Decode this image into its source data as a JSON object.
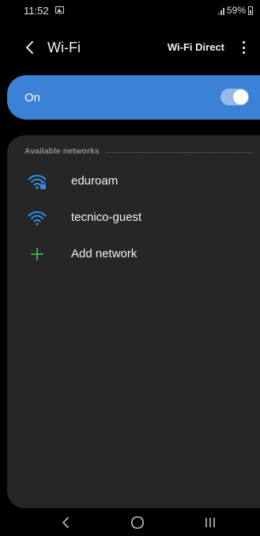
{
  "status_bar": {
    "time": "11:52",
    "battery": "59%"
  },
  "header": {
    "title": "Wi-Fi",
    "wifi_direct_label": "Wi-Fi Direct"
  },
  "wifi_toggle": {
    "label": "On",
    "enabled": true
  },
  "networks": {
    "section_title": "Available networks",
    "items": [
      {
        "name": "eduroam",
        "icon": "wifi-locked-icon",
        "secured": true
      },
      {
        "name": "tecnico-guest",
        "icon": "wifi-icon",
        "secured": false
      }
    ],
    "add_label": "Add network"
  },
  "colors": {
    "accent": "#3b82d7",
    "wifi_icon": "#2f8fe6",
    "add_icon": "#3fbf4f",
    "card_background": "#262626",
    "page_background": "#000000"
  },
  "icons": {
    "back": "back-chevron-icon",
    "more": "more-vertical-icon",
    "add": "plus-icon",
    "nav_back": "nav-back-icon",
    "nav_home": "nav-home-icon",
    "nav_recents": "nav-recents-icon"
  }
}
